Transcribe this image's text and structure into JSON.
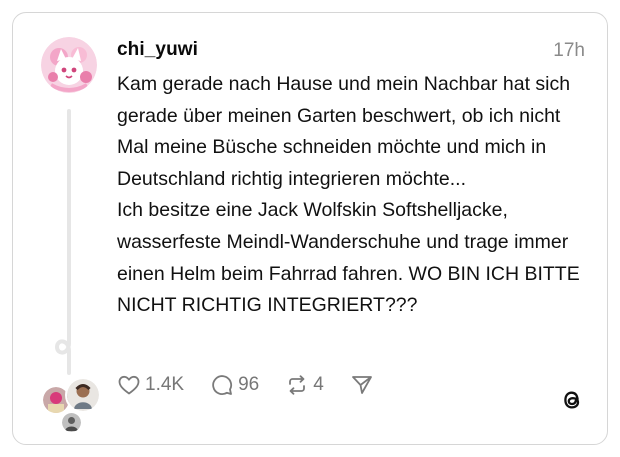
{
  "post": {
    "username": "chi_yuwi",
    "timestamp": "17h",
    "lines": [
      "Kam gerade nach Hause und mein Nachbar hat sich gerade über meinen Garten beschwert, ob ich nicht Mal meine Büsche schneiden möchte und mich in Deutschland richtig integrieren möchte...",
      "Ich besitze eine Jack Wolfskin Softshelljacke, wasserfeste Meindl-Wanderschuhe und trage immer einen Helm beim Fahrrad fahren. WO BIN ICH BITTE NICHT RICHTIG INTEGRIERT???"
    ]
  },
  "actions": {
    "likes": "1.4K",
    "comments": "96",
    "reposts": "4"
  },
  "colors": {
    "border": "#d6d6d6",
    "muted": "#8a8a8a",
    "thread_line": "#e6e6e6",
    "avatar_pink": "#f3a6c8"
  }
}
